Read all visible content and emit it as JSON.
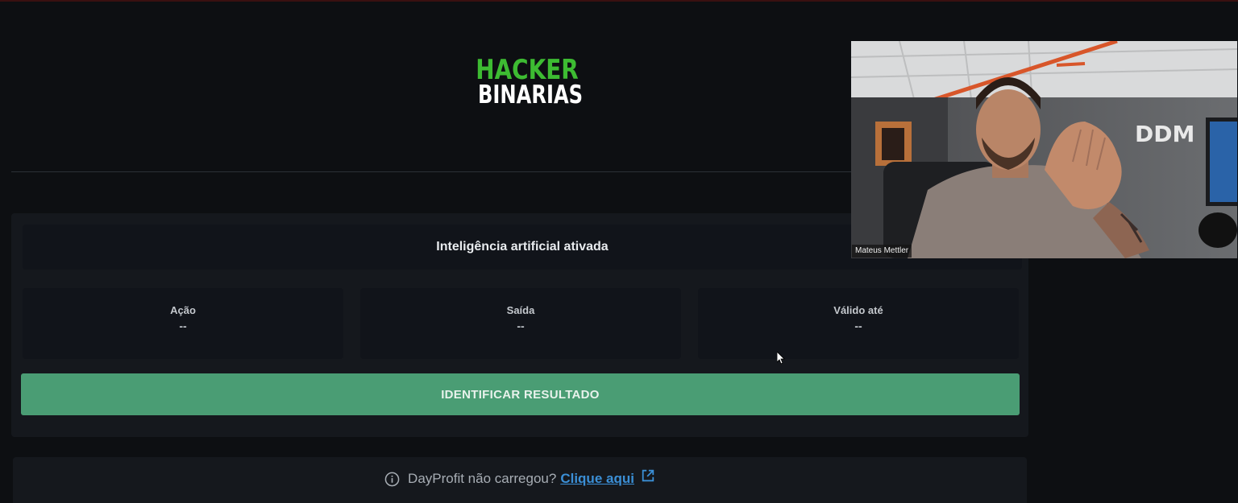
{
  "logo": {
    "line1": "HACKER",
    "line2": "BINARIAS"
  },
  "panel": {
    "ai_status": "Inteligência artificial ativada",
    "fields": [
      {
        "label": "Ação",
        "value": "--"
      },
      {
        "label": "Saída",
        "value": "--"
      },
      {
        "label": "Válido até",
        "value": "--"
      }
    ],
    "identify_button": "IDENTIFICAR RESULTADO"
  },
  "notice": {
    "icon": "info-icon",
    "text": "DayProfit não carregou?",
    "link_text": "Clique aqui",
    "link_icon": "external-link-icon"
  },
  "webcam": {
    "participant_name": "Mateus Mettler",
    "wall_logo": "DDM"
  },
  "colors": {
    "background": "#0d0f12",
    "panel": "#15181d",
    "button": "#4a9d74",
    "logo_green": "#3dbb32",
    "link": "#3b8fd6"
  }
}
